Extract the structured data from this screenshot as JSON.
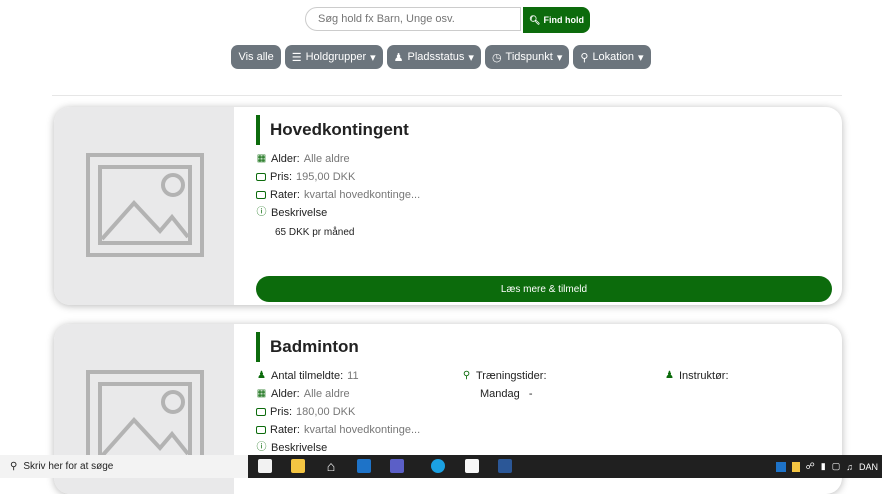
{
  "search": {
    "placeholder": "Søg hold fx Barn, Unge osv.",
    "button_label": "Find hold"
  },
  "filters": [
    {
      "label": "Vis alle",
      "icon": ""
    },
    {
      "label": "Holdgrupper",
      "icon": "list-icon"
    },
    {
      "label": "Pladsstatus",
      "icon": "users-icon"
    },
    {
      "label": "Tidspunkt",
      "icon": "clock-icon"
    },
    {
      "label": "Lokation",
      "icon": "map-marker-icon"
    }
  ],
  "cards": [
    {
      "title": "Hovedkontingent",
      "alder_label": "Alder:",
      "alder_value": "Alle aldre",
      "pris_label": "Pris:",
      "pris_value": "195,00 DKK",
      "rater_label": "Rater:",
      "rater_value": "kvartal hovedkontinge...",
      "beskrivelse_label": "Beskrivelse",
      "beskrivelse_text": "65 DKK pr måned",
      "cta_label": "Læs mere & tilmeld"
    },
    {
      "title": "Badminton",
      "tilmeldte_label": "Antal tilmeldte:",
      "tilmeldte_value": "11",
      "alder_label": "Alder:",
      "alder_value": "Alle aldre",
      "pris_label": "Pris:",
      "pris_value": "180,00 DKK",
      "rater_label": "Rater:",
      "rater_value": "kvartal hovedkontinge...",
      "beskrivelse_label": "Beskrivelse",
      "traening_label": "Træningstider:",
      "traening_value": "Mandag   -",
      "instruktor_label": "Instruktør:"
    }
  ],
  "taskbar": {
    "search_text": "Skriv her for at søge",
    "language": "DAN"
  },
  "colors": {
    "primary": "#0c6b0c",
    "filter": "#6c757d",
    "placeholder_bg": "#e9e9ea"
  }
}
